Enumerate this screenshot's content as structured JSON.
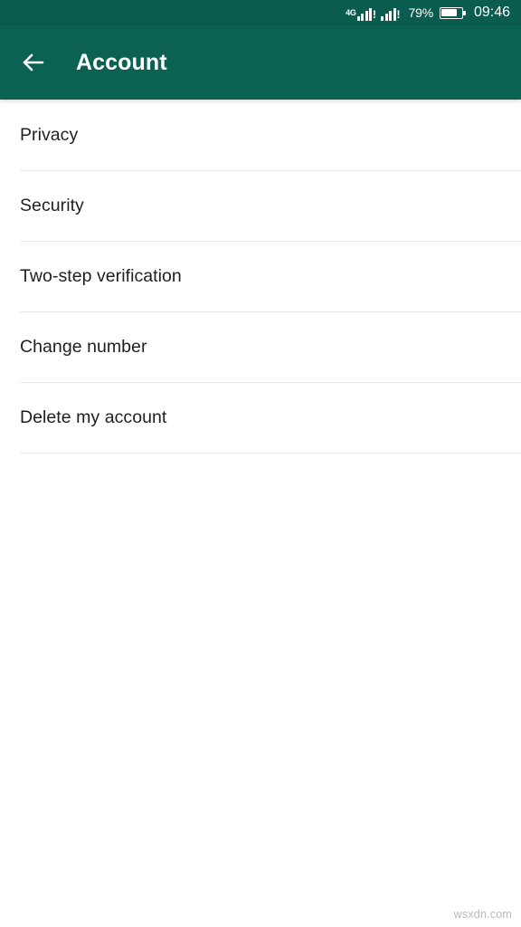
{
  "status_bar": {
    "network_label": "4G",
    "sim1_alert": "!",
    "sim2_alert": "!",
    "battery_percent": "79%",
    "battery_level": 79,
    "time": "09:46",
    "background_color": "#0a5c4f"
  },
  "app_bar": {
    "back_icon": "arrow-left-icon",
    "title": "Account",
    "background_color": "#0b6252",
    "text_color": "#ffffff"
  },
  "list": {
    "items": [
      {
        "label": "Privacy"
      },
      {
        "label": "Security"
      },
      {
        "label": "Two-step verification"
      },
      {
        "label": "Change number"
      },
      {
        "label": "Delete my account"
      }
    ],
    "divider_color": "#e8e8e8",
    "text_color": "#1f1f1f"
  },
  "watermark": {
    "text": "wsxdn.com",
    "color": "#b9b9b9"
  }
}
